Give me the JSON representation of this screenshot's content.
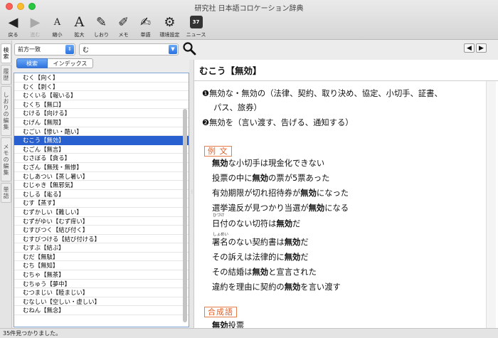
{
  "window": {
    "title": "研究社 日本語コロケーション辞典"
  },
  "toolbar": [
    {
      "icon": "◀",
      "label": "戻る",
      "enabled": true
    },
    {
      "icon": "▶",
      "label": "進む",
      "enabled": false
    },
    {
      "icon": "A",
      "label": "縮小",
      "enabled": true
    },
    {
      "icon": "A",
      "label": "拡大",
      "enabled": true
    },
    {
      "icon": "✎",
      "label": "しおり",
      "enabled": true
    },
    {
      "icon": "✐",
      "label": "メモ",
      "enabled": true
    },
    {
      "icon": "✍",
      "label": "単語",
      "enabled": true
    },
    {
      "icon": "⚙",
      "label": "環境設定",
      "enabled": true
    },
    {
      "icon": "37",
      "label": "ニュース",
      "enabled": true
    }
  ],
  "side_tabs": [
    "検索",
    "履歴",
    "しおりの編集",
    "メモの編集",
    "単語"
  ],
  "search": {
    "mode": "前方一致",
    "query": "む"
  },
  "list_tabs": {
    "search": "検索",
    "index": "インデックス"
  },
  "results": [
    "むく【向く】",
    "むく【剥く】",
    "むくいる【報いる】",
    "むくち【無口】",
    "むける【向ける】",
    "むげん【無限】",
    "むごい【惨い・酷い】",
    "むこう【無効】",
    "むごん【無言】",
    "むさぼる【貪る】",
    "むざん【無残・無惨】",
    "むしあつい【蒸し暑い】",
    "むじゃき【無邪気】",
    "むしる【毟る】",
    "むす【蒸す】",
    "むずかしい【難しい】",
    "むずがゆい【むず痒い】",
    "むすびつく【結び付く】",
    "むすびつける【結び付ける】",
    "むすぶ【結ぶ】",
    "むだ【無駄】",
    "むち【無知】",
    "むちゃ【無茶】",
    "むちゅう【夢中】",
    "むつまじい【睦まじい】",
    "むなしい【空しい・虚しい】",
    "むねん【無念】"
  ],
  "selected_index": 7,
  "entry": {
    "headword": "むこう【無効】",
    "definitions": [
      "❶無効な・無効の（法律、契約、取り決め、協定、小切手、証書、",
      "パス、旅券）",
      "❷無効を（言い渡す、告げる、通知する）"
    ],
    "examples_label": "例 文",
    "examples": [
      [
        [
          "無効",
          "b"
        ],
        [
          "な小切手は現金化できない",
          ""
        ]
      ],
      [
        [
          "投票の中に",
          ""
        ],
        [
          "無効",
          "b"
        ],
        [
          "の票が5票あった",
          ""
        ]
      ],
      [
        [
          "有効期限が切れ招待券が",
          ""
        ],
        [
          "無効",
          "b"
        ],
        [
          "になった",
          ""
        ]
      ],
      [
        [
          "選挙違反が見つかり当選が",
          ""
        ],
        [
          "無効",
          "b"
        ],
        [
          "になる",
          ""
        ]
      ],
      [
        [
          "日付のない切符は",
          ""
        ],
        [
          "無効",
          "b"
        ],
        [
          "だ",
          ""
        ]
      ],
      [
        [
          "署名のない契約書は",
          ""
        ],
        [
          "無効",
          "b"
        ],
        [
          "だ",
          ""
        ]
      ],
      [
        [
          "その訴えは法律的に",
          ""
        ],
        [
          "無効",
          "b"
        ],
        [
          "だ",
          ""
        ]
      ],
      [
        [
          "その結婚は",
          ""
        ],
        [
          "無効",
          "b"
        ],
        [
          "と宣言された",
          ""
        ]
      ],
      [
        [
          "違約を理由に契約の",
          ""
        ],
        [
          "無効",
          "b"
        ],
        [
          "を言い渡す",
          ""
        ]
      ]
    ],
    "ruby": {
      "hizuke": "ひづけ",
      "shomei": "しょめい"
    },
    "compounds_label": "合成語",
    "compounds": [
      [
        [
          "無効",
          "b"
        ],
        [
          "投票",
          ""
        ]
      ]
    ]
  },
  "status": "35件見つかりました。",
  "colors": {
    "accent": "#2860cf",
    "section": "#e0602a"
  }
}
